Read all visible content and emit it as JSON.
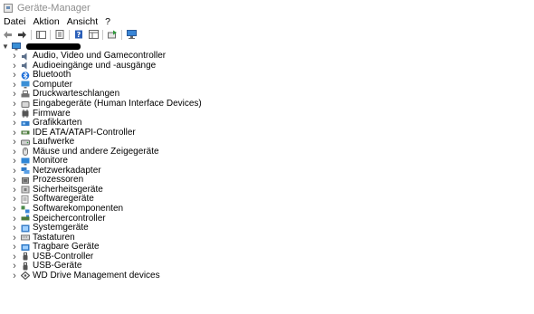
{
  "window": {
    "title": "Geräte-Manager"
  },
  "menu": {
    "items": [
      "Datei",
      "Aktion",
      "Ansicht",
      "?"
    ]
  },
  "toolbar": {
    "buttons": [
      "back-icon",
      "forward-icon",
      "show-hide-tree-icon",
      "properties-icon",
      "help-icon",
      "view-icon",
      "update-driver-icon",
      "scan-hardware-icon"
    ]
  },
  "tree": {
    "root_label": "",
    "categories": [
      {
        "label": "Audio, Video und Gamecontroller",
        "icon": "speaker-icon",
        "color": "#5b6f8a"
      },
      {
        "label": "Audioeingänge und -ausgänge",
        "icon": "speaker-icon",
        "color": "#5b6f8a"
      },
      {
        "label": "Bluetooth",
        "icon": "bluetooth-icon",
        "color": "#1e6fd9"
      },
      {
        "label": "Computer",
        "icon": "computer-icon",
        "color": "#3a8fd6"
      },
      {
        "label": "Druckwarteschlangen",
        "icon": "printer-icon",
        "color": "#707070"
      },
      {
        "label": "Eingabegeräte (Human Interface Devices)",
        "icon": "hid-icon",
        "color": "#6d6d6d"
      },
      {
        "label": "Firmware",
        "icon": "chip-icon",
        "color": "#555555"
      },
      {
        "label": "Grafikkarten",
        "icon": "display-adapter-icon",
        "color": "#2f7ac7"
      },
      {
        "label": "IDE ATA/ATAPI-Controller",
        "icon": "ide-icon",
        "color": "#4a7a3a"
      },
      {
        "label": "Laufwerke",
        "icon": "drive-icon",
        "color": "#6b6b6b"
      },
      {
        "label": "Mäuse und andere Zeigegeräte",
        "icon": "mouse-icon",
        "color": "#707070"
      },
      {
        "label": "Monitore",
        "icon": "monitor-icon",
        "color": "#2f86d6"
      },
      {
        "label": "Netzwerkadapter",
        "icon": "network-icon",
        "color": "#2f7ac7"
      },
      {
        "label": "Prozessoren",
        "icon": "processor-icon",
        "color": "#6a6a6a"
      },
      {
        "label": "Sicherheitsgeräte",
        "icon": "security-icon",
        "color": "#7a7a7a"
      },
      {
        "label": "Softwaregeräte",
        "icon": "software-device-icon",
        "color": "#8a8a8a"
      },
      {
        "label": "Softwarekomponenten",
        "icon": "software-component-icon",
        "color": "#4a8a4a"
      },
      {
        "label": "Speichercontroller",
        "icon": "storage-controller-icon",
        "color": "#4a7a3a"
      },
      {
        "label": "Systemgeräte",
        "icon": "system-device-icon",
        "color": "#3a7fc8"
      },
      {
        "label": "Tastaturen",
        "icon": "keyboard-icon",
        "color": "#707070"
      },
      {
        "label": "Tragbare Geräte",
        "icon": "portable-device-icon",
        "color": "#2f7ac7"
      },
      {
        "label": "USB-Controller",
        "icon": "usb-icon",
        "color": "#555555"
      },
      {
        "label": "USB-Geräte",
        "icon": "usb-icon",
        "color": "#555555"
      },
      {
        "label": "WD Drive Management devices",
        "icon": "diamond-icon",
        "color": "#555555"
      }
    ]
  }
}
